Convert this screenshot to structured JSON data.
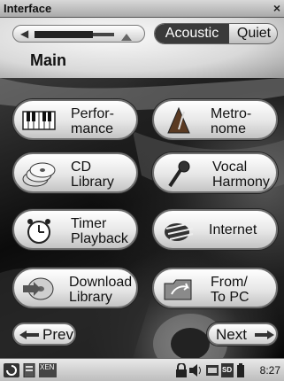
{
  "window": {
    "title": "Interface",
    "close_glyph": "×"
  },
  "volume": {
    "level": 0.66,
    "icon": "speaker-icon"
  },
  "sound_mode": {
    "options": [
      "Acoustic",
      "Quiet"
    ],
    "selected": "Acoustic"
  },
  "page": {
    "heading": "Main"
  },
  "menu": {
    "performance": {
      "label": "Perfor-\nmance",
      "icon": "piano-keyboard-icon"
    },
    "metronome": {
      "label": "Metro-\nnome",
      "icon": "metronome-icon"
    },
    "cd_library": {
      "label": "CD\nLibrary",
      "icon": "cd-discs-icon"
    },
    "vocal_harmony": {
      "label": "Vocal\nHarmony",
      "icon": "microphone-icon"
    },
    "timer_playback": {
      "label": "Timer\nPlayback",
      "icon": "alarm-clock-icon"
    },
    "internet": {
      "label": "Internet",
      "icon": "internet-globe-icon"
    },
    "download_library": {
      "label": "Download\nLibrary",
      "icon": "download-disc-icon"
    },
    "from_to_pc": {
      "label": "From/\nTo PC",
      "icon": "folder-transfer-icon"
    }
  },
  "navigation": {
    "prev": "Prev",
    "next": "Next"
  },
  "taskbar": {
    "clock": "8:27",
    "xen_label": "XEN",
    "sd_label": "SD"
  },
  "colors": {
    "selected_mode_bg": "#3a3a3a",
    "pill_border": "#6f6f6f"
  }
}
